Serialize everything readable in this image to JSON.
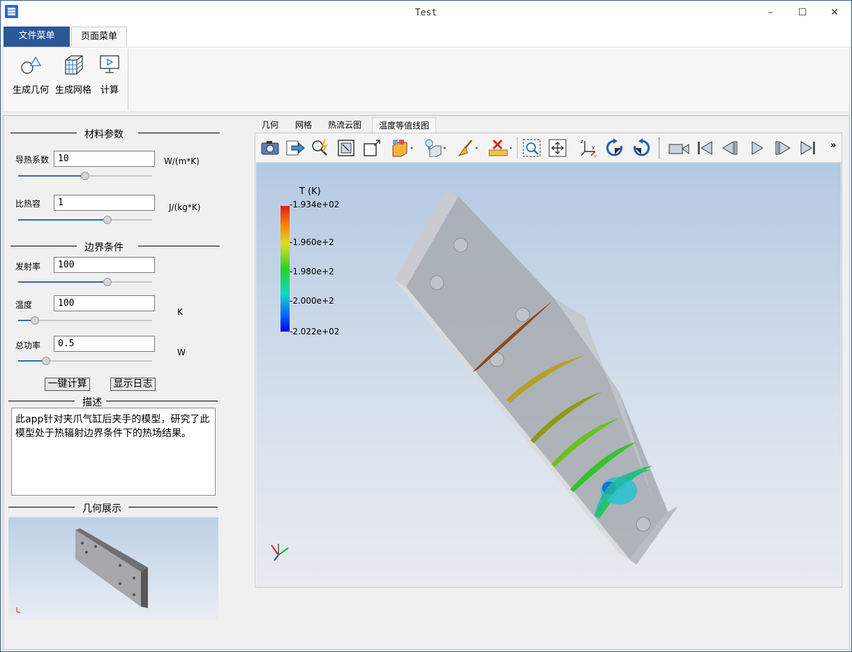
{
  "window": {
    "title": "Test",
    "controls": {
      "minimize": "–",
      "maximize": "☐",
      "close": "✕"
    }
  },
  "menu_tabs": {
    "file": "文件菜单",
    "page": "页面菜单"
  },
  "ribbon": {
    "geometry": "生成几何",
    "mesh": "生成网格",
    "compute": "计算"
  },
  "material": {
    "header": "材料参数",
    "conductivity": {
      "label": "导热系数",
      "value": "10",
      "unit": "W/(m*K)",
      "slider": 0.5
    },
    "heat_capacity": {
      "label": "比热容",
      "value": "1",
      "unit": "J/(kg*K)",
      "slider": 0.68
    }
  },
  "boundary": {
    "header": "边界条件",
    "emissivity": {
      "label": "发射率",
      "value": "100",
      "slider": 0.68
    },
    "temperature": {
      "label": "温度",
      "value": "100",
      "unit": "K",
      "slider": 0.1
    },
    "power": {
      "label": "总功率",
      "value": "0.5",
      "unit": "W",
      "slider": 0.19
    }
  },
  "actions": {
    "compute": "一键计算",
    "log": "显示日志"
  },
  "description": {
    "header": "描述",
    "text": "此app针对夹爪气缸后夹手的模型，研究了此模型处于热辐射边界条件下的热场结果。"
  },
  "geometry_display": {
    "header": "几何展示"
  },
  "view_tabs": [
    "几何",
    "网格",
    "热流云图",
    "温度等值线图"
  ],
  "toolbar_overflow": "»",
  "colorbar": {
    "title": "T (K)",
    "labels": [
      "-1.934e+02",
      "-1.960e+2",
      "-1.980e+2",
      "-2.000e+2",
      "-2.022e+02"
    ]
  },
  "colors": {
    "accent": "#2b5797",
    "slider": "#2d6ab7"
  }
}
